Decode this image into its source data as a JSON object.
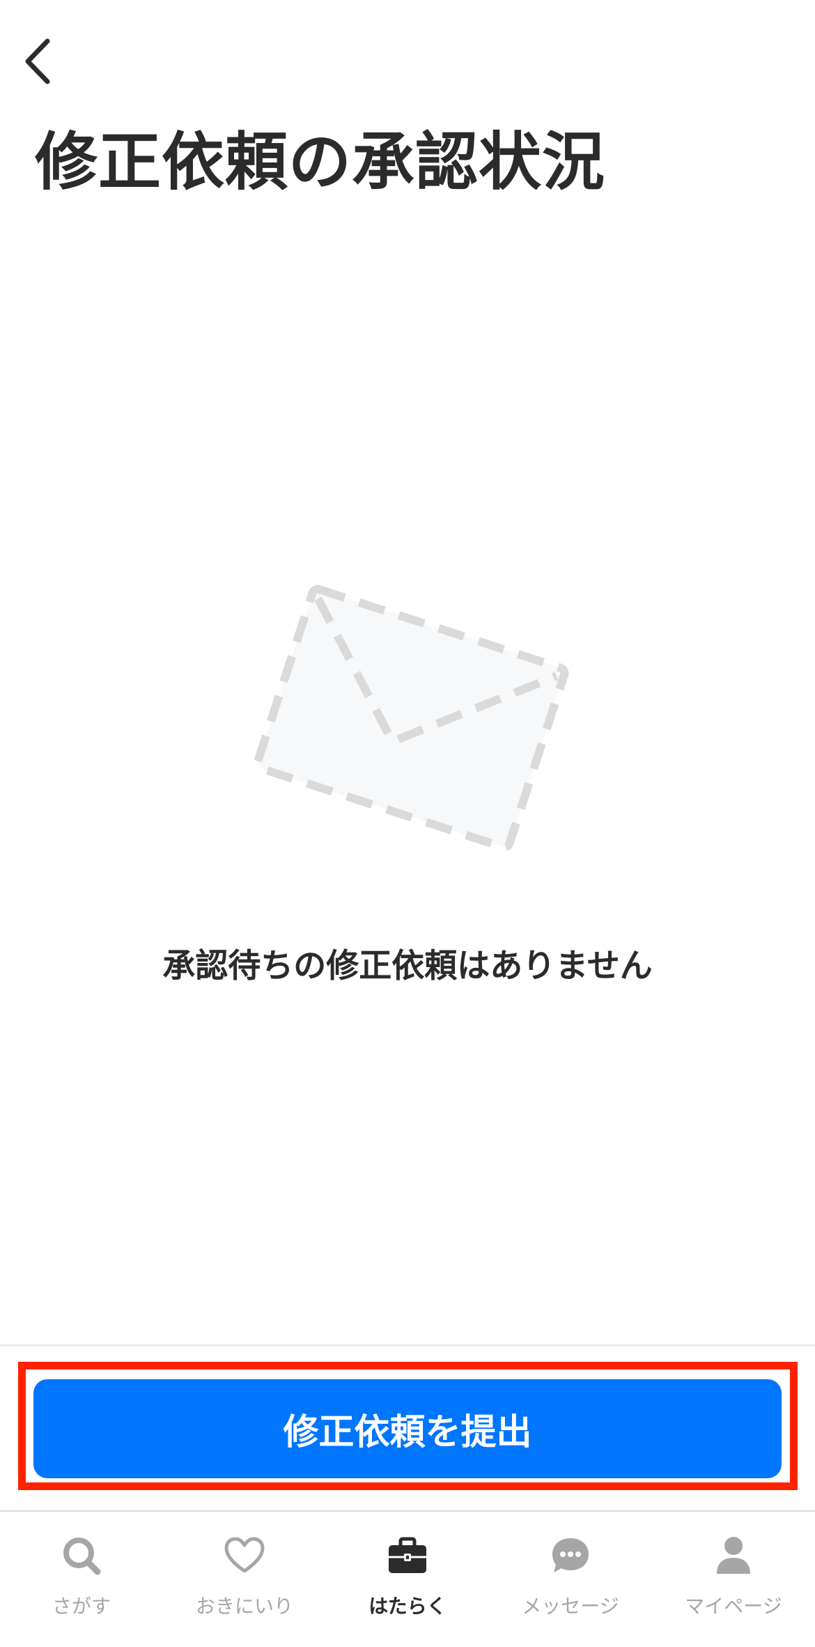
{
  "header": {
    "back_icon": "chevron-left-icon",
    "title": "修正依頼の承認状況"
  },
  "empty_state": {
    "icon": "envelope-dashed-icon",
    "message": "承認待ちの修正依頼はありません"
  },
  "action": {
    "submit_label": "修正依頼を提出",
    "button_color": "#0076ff",
    "highlight_color": "#ff2200"
  },
  "tab_bar": {
    "active_index": 2,
    "active_color": "#2b2b2b",
    "inactive_color": "#a6a6a6",
    "items": [
      {
        "label": "さがす",
        "icon": "search-icon"
      },
      {
        "label": "おきにいり",
        "icon": "heart-icon"
      },
      {
        "label": "はたらく",
        "icon": "briefcase-icon"
      },
      {
        "label": "メッセージ",
        "icon": "chat-bubble-icon"
      },
      {
        "label": "マイページ",
        "icon": "person-icon"
      }
    ]
  }
}
